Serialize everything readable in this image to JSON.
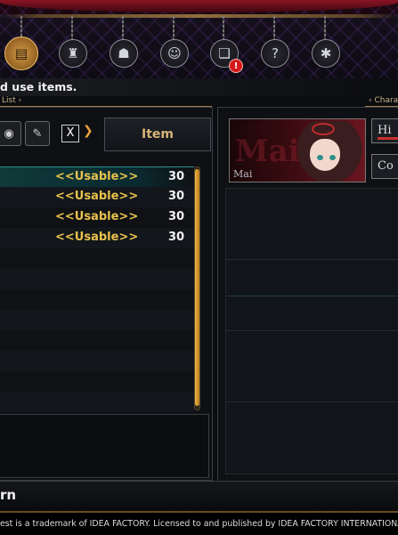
{
  "header": {
    "menu_icons": [
      {
        "name": "items-icon",
        "glyph": "▤",
        "active": true
      },
      {
        "name": "equipment-icon",
        "glyph": "♜",
        "active": false
      },
      {
        "name": "party-icon",
        "glyph": "☗",
        "active": false
      },
      {
        "name": "character-icon",
        "glyph": "☺",
        "active": false
      },
      {
        "name": "book-icon",
        "glyph": "❏",
        "active": false
      },
      {
        "name": "quest-icon",
        "glyph": "?",
        "active": false
      },
      {
        "name": "system-icon",
        "glyph": "✱",
        "active": false
      }
    ],
    "alert_badge": "!"
  },
  "instruction": "d use items.",
  "subheaders": {
    "left": "List",
    "right": "Chara"
  },
  "item_list": {
    "column_header": "Item",
    "filter_button": "X",
    "rows": [
      {
        "status": "<<Usable>>",
        "qty": "30",
        "selected": true
      },
      {
        "status": "<<Usable>>",
        "qty": "30",
        "selected": false
      },
      {
        "status": "<<Usable>>",
        "qty": "30",
        "selected": false
      },
      {
        "status": "<<Usable>>",
        "qty": "30",
        "selected": false
      }
    ]
  },
  "character": {
    "name": "Mai",
    "name_bg": "Mai",
    "tabs": [
      "Hi",
      "Co"
    ]
  },
  "bottom": {
    "return_label": "rn"
  },
  "footer": {
    "copyright": "est is a trademark of IDEA FACTORY. Licensed to and published by IDEA FACTORY INTERNATIONAL."
  }
}
